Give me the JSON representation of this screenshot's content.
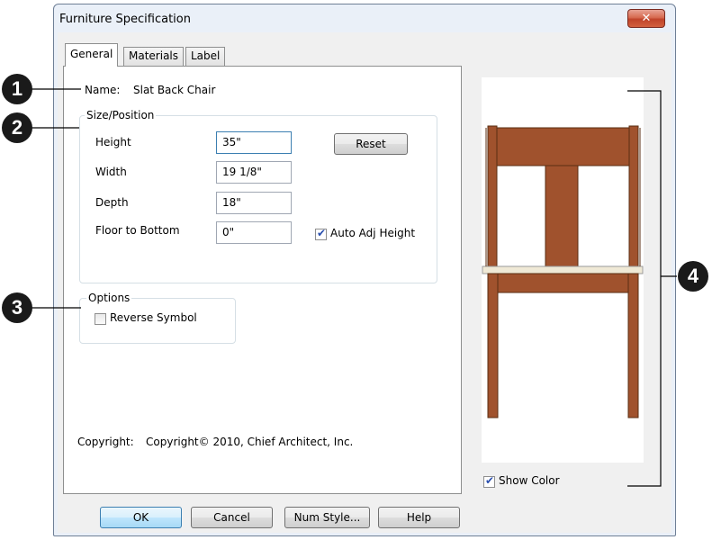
{
  "window": {
    "title": "Furniture Specification",
    "close_glyph": "✕"
  },
  "tabs": [
    {
      "label": "General"
    },
    {
      "label": "Materials"
    },
    {
      "label": "Label"
    }
  ],
  "general": {
    "name_label": "Name:",
    "name_value": "Slat Back Chair",
    "size_group": {
      "legend": "Size/Position",
      "height_label": "Height",
      "height_value": "35\"",
      "width_label": "Width",
      "width_value": "19 1/8\"",
      "depth_label": "Depth",
      "depth_value": "18\"",
      "floor_label": "Floor to Bottom",
      "floor_value": "0\"",
      "reset_label": "Reset",
      "auto_adj_label": "Auto Adj Height",
      "auto_adj_checked": true
    },
    "options_group": {
      "legend": "Options",
      "reverse_label": "Reverse Symbol",
      "reverse_checked": false
    },
    "copyright_label": "Copyright:",
    "copyright_value": "Copyright© 2010, Chief Architect, Inc."
  },
  "preview": {
    "show_color_label": "Show Color",
    "show_color_checked": true,
    "chair_color": "#a0522d",
    "seat_color": "#efe9d6"
  },
  "buttons": {
    "ok": "OK",
    "cancel": "Cancel",
    "num_style": "Num Style...",
    "help": "Help"
  },
  "callouts": [
    "1",
    "2",
    "3",
    "4"
  ]
}
